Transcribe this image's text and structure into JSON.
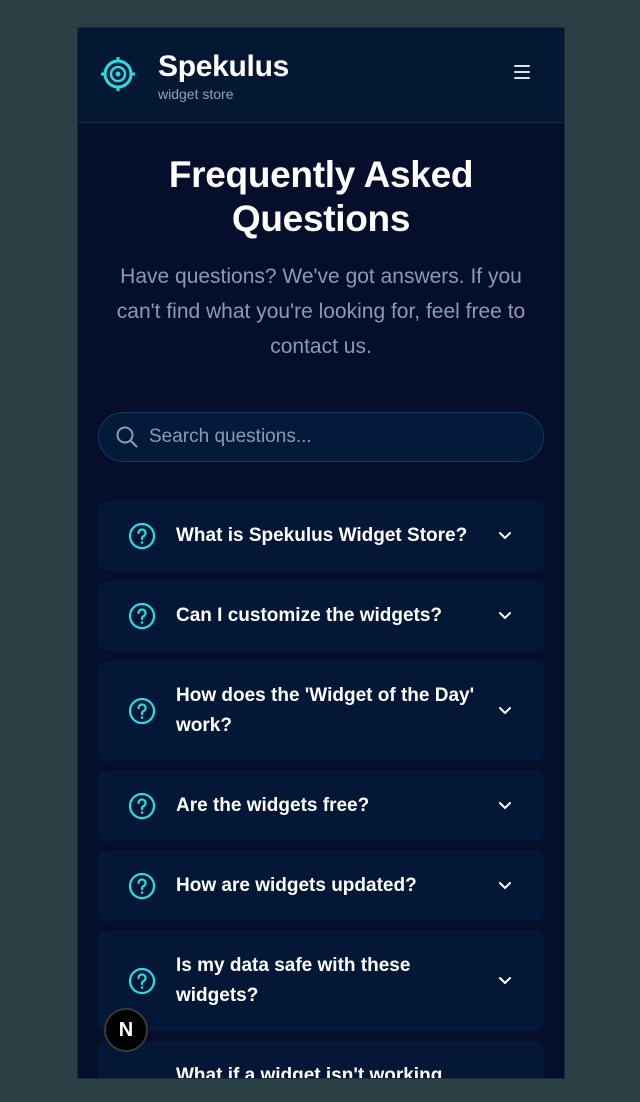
{
  "header": {
    "brand_name": "Spekulus",
    "brand_subtitle": "widget store",
    "logo_icon": "crosshair-gear-icon",
    "menu_icon": "hamburger-menu-icon"
  },
  "hero": {
    "title": "Frequently Asked Questions",
    "description": "Have questions? We've got answers. If you can't find what you're looking for, feel free to contact us."
  },
  "search": {
    "placeholder": "Search questions...",
    "value": ""
  },
  "faqs": [
    {
      "question": "What is Spekulus Widget Store?"
    },
    {
      "question": "Can I customize the widgets?"
    },
    {
      "question": "How does the 'Widget of the Day' work?"
    },
    {
      "question": "Are the widgets free?"
    },
    {
      "question": "How are widgets updated?"
    },
    {
      "question": "Is my data safe with these widgets?"
    },
    {
      "question": "What if a widget isn't working properly?"
    }
  ],
  "dev_badge": {
    "label": "N"
  },
  "colors": {
    "accent": "#22e0e8",
    "background": "#050e2a",
    "card": "#041736",
    "outer": "#2a4045"
  }
}
